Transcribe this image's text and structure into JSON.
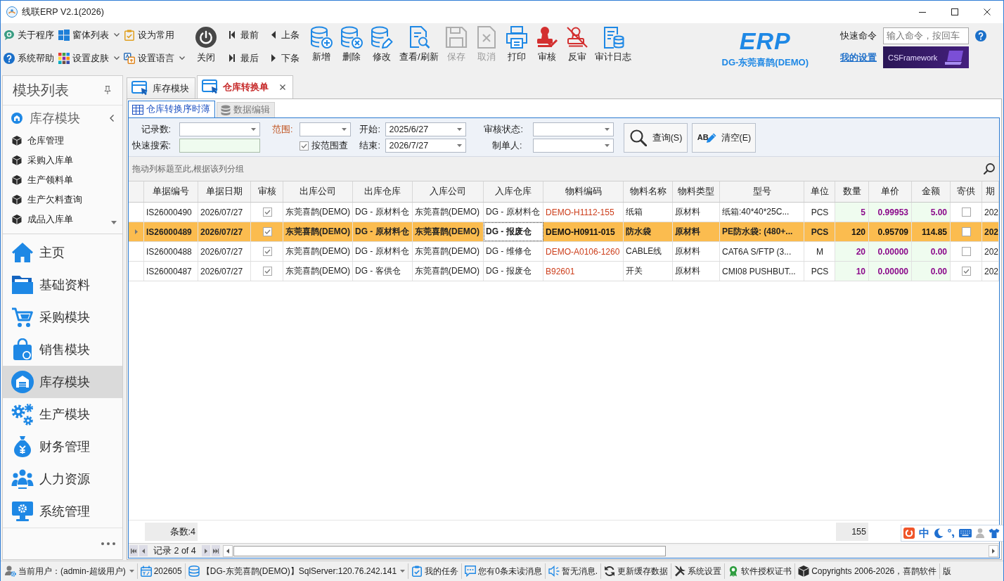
{
  "window": {
    "title": "线联ERP V2.1(2026)"
  },
  "toolbar": {
    "quick_links": [
      {
        "label": "关于程序",
        "dropdown": false
      },
      {
        "label": "窗体列表",
        "dropdown": true
      },
      {
        "label": "设为常用",
        "dropdown": false
      },
      {
        "label": "系统帮助",
        "dropdown": false
      },
      {
        "label": "设置皮肤",
        "dropdown": true
      },
      {
        "label": "设置语言",
        "dropdown": true
      }
    ],
    "close_button": {
      "label": "关闭"
    },
    "record_nav": [
      {
        "label": "最前"
      },
      {
        "label": "上条"
      },
      {
        "label": "最后"
      },
      {
        "label": "下条"
      }
    ],
    "actions": [
      {
        "label": "新增",
        "disabled": false
      },
      {
        "label": "删除",
        "disabled": false
      },
      {
        "label": "修改",
        "disabled": false
      },
      {
        "label": "查看/刷新",
        "disabled": false
      },
      {
        "label": "保存",
        "disabled": true
      },
      {
        "label": "取消",
        "disabled": true
      },
      {
        "label": "打印",
        "disabled": false
      },
      {
        "label": "审核",
        "disabled": false
      },
      {
        "label": "反审",
        "disabled": false
      },
      {
        "label": "审计日志",
        "disabled": false
      }
    ]
  },
  "brand": {
    "logo": "ERP",
    "company": "DG-东莞喜鹊(DEMO)"
  },
  "quick_command": {
    "label": "快速命令",
    "placeholder": "输入命令，按回车"
  },
  "my_settings_link": "我的设置",
  "banner": {
    "text": "CSFramework"
  },
  "sidebar": {
    "title": "模块列表",
    "group": {
      "label": "库存模块"
    },
    "items": [
      {
        "label": "仓库管理"
      },
      {
        "label": "采购入库单"
      },
      {
        "label": "生产领料单"
      },
      {
        "label": "生产欠料查询"
      },
      {
        "label": "成品入库单"
      }
    ],
    "modules": [
      {
        "label": "主页",
        "selected": false
      },
      {
        "label": "基础资料",
        "selected": false
      },
      {
        "label": "采购模块",
        "selected": false
      },
      {
        "label": "销售模块",
        "selected": false
      },
      {
        "label": "库存模块",
        "selected": true
      },
      {
        "label": "生产模块",
        "selected": false
      },
      {
        "label": "财务管理",
        "selected": false
      },
      {
        "label": "人力资源",
        "selected": false
      },
      {
        "label": "系统管理",
        "selected": false
      }
    ]
  },
  "document_tabs": [
    {
      "label": "库存模块",
      "selected": false,
      "closable": false
    },
    {
      "label": "仓库转换单",
      "selected": true,
      "closable": true
    }
  ],
  "view_tabs": [
    {
      "label": "仓库转换序时薄",
      "selected": true
    },
    {
      "label": "数据编辑",
      "selected": false
    }
  ],
  "filters": {
    "record_count": {
      "label": "记录数:"
    },
    "quick_search": {
      "label": "快速搜索:"
    },
    "range": {
      "label": "范围:"
    },
    "range_check": {
      "label": "按范围查",
      "checked": true
    },
    "start": {
      "label": "开始:",
      "value": "2025/6/27"
    },
    "end": {
      "label": "结束:",
      "value": "2026/7/27"
    },
    "audit_status": {
      "label": "审核状态:"
    },
    "creator": {
      "label": "制单人:"
    },
    "search_button": {
      "label": "查询(S)"
    },
    "clear_button": {
      "label": "清空(E)",
      "icon_text": "AB"
    }
  },
  "grid": {
    "group_panel_hint": "拖动列标题至此,根据该列分组",
    "columns": [
      {
        "label": "单据编号",
        "kind": "text",
        "footer": "条数:4"
      },
      {
        "label": "单据日期",
        "kind": "text"
      },
      {
        "label": "审核",
        "kind": "check"
      },
      {
        "label": "出库公司",
        "kind": "text"
      },
      {
        "label": "出库仓库",
        "kind": "text"
      },
      {
        "label": "入库公司",
        "kind": "text"
      },
      {
        "label": "入库仓库",
        "kind": "text"
      },
      {
        "label": "物料编码",
        "kind": "code"
      },
      {
        "label": "物料名称",
        "kind": "text"
      },
      {
        "label": "物料类型",
        "kind": "text"
      },
      {
        "label": "型号",
        "kind": "text"
      },
      {
        "label": "单位",
        "kind": "unit"
      },
      {
        "label": "数量",
        "kind": "number",
        "footer": "155"
      },
      {
        "label": "单价",
        "kind": "number"
      },
      {
        "label": "金额",
        "kind": "number"
      },
      {
        "label": "寄供",
        "kind": "check"
      },
      {
        "label": "期",
        "kind": "text"
      }
    ],
    "rows": [
      {
        "selected": false,
        "cells": [
          {
            "text": "IS26000490",
            "focused": false
          },
          {
            "text": "2026/07/27",
            "focused": false
          },
          {
            "checked": true,
            "focused": false
          },
          {
            "text": "东莞喜鹊(DEMO)",
            "focused": false
          },
          {
            "text": "DG - 原材料仓",
            "focused": false
          },
          {
            "text": "东莞喜鹊(DEMO)",
            "focused": false
          },
          {
            "text": "DG - 原材料仓",
            "focused": false
          },
          {
            "text": "DEMO-H1112-155",
            "focused": false
          },
          {
            "text": "纸箱",
            "focused": false
          },
          {
            "text": "原材料",
            "focused": false
          },
          {
            "text": "纸箱:40*40*25C...",
            "focused": false
          },
          {
            "text": "PCS",
            "focused": false
          },
          {
            "text": "5",
            "focused": false
          },
          {
            "text": "0.99953",
            "focused": false
          },
          {
            "text": "5.00",
            "focused": false
          },
          {
            "checked": false,
            "focused": false
          },
          {
            "text": "202",
            "focused": false
          }
        ]
      },
      {
        "selected": true,
        "cells": [
          {
            "text": "IS26000489",
            "focused": false
          },
          {
            "text": "2026/07/27",
            "focused": false
          },
          {
            "checked": true,
            "focused": false
          },
          {
            "text": "东莞喜鹊(DEMO)",
            "focused": false
          },
          {
            "text": "DG - 原材料仓",
            "focused": false
          },
          {
            "text": "东莞喜鹊(DEMO)",
            "focused": false
          },
          {
            "text": "DG - 报废仓",
            "focused": true
          },
          {
            "text": "DEMO-H0911-015",
            "focused": false
          },
          {
            "text": "防水袋",
            "focused": false
          },
          {
            "text": "原材料",
            "focused": false
          },
          {
            "text": "PE防水袋: (480+...",
            "focused": false
          },
          {
            "text": "PCS",
            "focused": false
          },
          {
            "text": "120",
            "focused": false
          },
          {
            "text": "0.95709",
            "focused": false
          },
          {
            "text": "114.85",
            "focused": false
          },
          {
            "checked": false,
            "focused": false
          },
          {
            "text": "202",
            "focused": false
          }
        ]
      },
      {
        "selected": false,
        "cells": [
          {
            "text": "IS26000488",
            "focused": false
          },
          {
            "text": "2026/07/27",
            "focused": false
          },
          {
            "checked": true,
            "focused": false
          },
          {
            "text": "东莞喜鹊(DEMO)",
            "focused": false
          },
          {
            "text": "DG - 原材料仓",
            "focused": false
          },
          {
            "text": "东莞喜鹊(DEMO)",
            "focused": false
          },
          {
            "text": "DG - 维修仓",
            "focused": false
          },
          {
            "text": "DEMO-A0106-1260",
            "focused": false
          },
          {
            "text": "CABLE线",
            "focused": false
          },
          {
            "text": "原材料",
            "focused": false
          },
          {
            "text": "CAT6A S/FTP (3...",
            "focused": false
          },
          {
            "text": "M",
            "focused": false
          },
          {
            "text": "20",
            "focused": false
          },
          {
            "text": "0.00000",
            "focused": false
          },
          {
            "text": "0.00",
            "focused": false
          },
          {
            "checked": false,
            "focused": false
          },
          {
            "text": "202",
            "focused": false
          }
        ]
      },
      {
        "selected": false,
        "cells": [
          {
            "text": "IS26000487",
            "focused": false
          },
          {
            "text": "2026/07/27",
            "focused": false
          },
          {
            "checked": true,
            "focused": false
          },
          {
            "text": "东莞喜鹊(DEMO)",
            "focused": false
          },
          {
            "text": "DG - 客供仓",
            "focused": false
          },
          {
            "text": "东莞喜鹊(DEMO)",
            "focused": false
          },
          {
            "text": "DG - 报废仓",
            "focused": false
          },
          {
            "text": "B92601",
            "focused": false
          },
          {
            "text": "开关",
            "focused": false
          },
          {
            "text": "原材料",
            "focused": false
          },
          {
            "text": "CMI08 PUSHBUT...",
            "focused": false
          },
          {
            "text": "PCS",
            "focused": false
          },
          {
            "text": "10",
            "focused": false
          },
          {
            "text": "0.00000",
            "focused": false
          },
          {
            "text": "0.00",
            "focused": false
          },
          {
            "checked": true,
            "focused": false
          },
          {
            "text": "202",
            "focused": false
          }
        ]
      }
    ]
  },
  "pager": {
    "label": "记录 2 of 4"
  },
  "ime_bar": {
    "mode": "中"
  },
  "status_bar": {
    "items": [
      {
        "label": "当前用户：(admin-超级用户)",
        "dropdown": true
      },
      {
        "label": "202605",
        "dropdown": false
      },
      {
        "label": "【DG-东莞喜鹊(DEMO)】SqlServer:120.76.242.141",
        "dropdown": true
      },
      {
        "label": "我的任务",
        "dropdown": false
      },
      {
        "label": "您有0条未读消息",
        "dropdown": false
      },
      {
        "label": "暂无消息.",
        "dropdown": false
      },
      {
        "label": "更新缓存数据",
        "dropdown": false
      },
      {
        "label": "系统设置",
        "dropdown": false
      },
      {
        "label": "软件授权证书",
        "dropdown": false
      },
      {
        "label": "Copyrights 2006-2026，喜鹊软件",
        "dropdown": false
      },
      {
        "label": "版",
        "dropdown": false
      }
    ]
  }
}
